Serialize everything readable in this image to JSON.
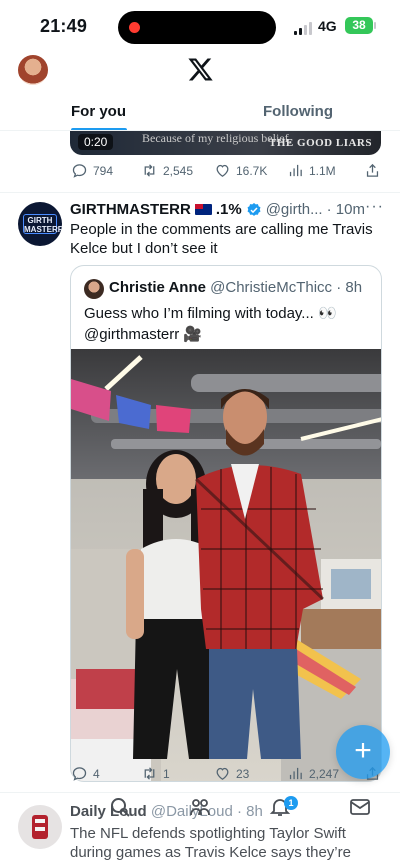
{
  "status_bar": {
    "time": "21:49",
    "network": "4G",
    "battery": "38",
    "recording_color": "#ff3b30"
  },
  "header": {
    "logo": "x-logo-icon",
    "tabs": [
      {
        "label": "For you",
        "active": true
      },
      {
        "label": "Following",
        "active": false
      }
    ],
    "accent": "#1d9bf0"
  },
  "prev_tweet": {
    "video_time": "0:20",
    "video_caption": "Because of my religious belief,",
    "video_brand": "THE GOOD LIARS",
    "stats": {
      "replies": "794",
      "reposts": "2,545",
      "likes": "16.7K",
      "views": "1.1M"
    }
  },
  "tweet": {
    "avatar_text": "GIRTH MASTERR",
    "name": "GIRTHMASTERR",
    "name_suffix": ".1%",
    "handle": "@girth...",
    "time": "· 10m",
    "text": "People in the comments are calling me Travis Kelce but I don’t see it",
    "quote": {
      "name": "Christie Anne",
      "handle": "@ChristieMcThicc",
      "time": "· 8h",
      "text": "Guess who I’m filming with today... 👀 @girthmasterr 🎥"
    },
    "stats": {
      "replies": "4",
      "reposts": "1",
      "likes": "23",
      "views": "2,247"
    }
  },
  "next_tweet": {
    "name": "Daily Loud",
    "handle": "@DailyLoud",
    "time": "· 8h",
    "text": "The NFL defends spotlighting Taylor Swift during games as Travis Kelce says they’re"
  },
  "bottom_nav": {
    "items": [
      "home-icon",
      "search-icon",
      "communities-icon",
      "notifications-icon",
      "messages-icon"
    ],
    "notification_count": "1"
  }
}
